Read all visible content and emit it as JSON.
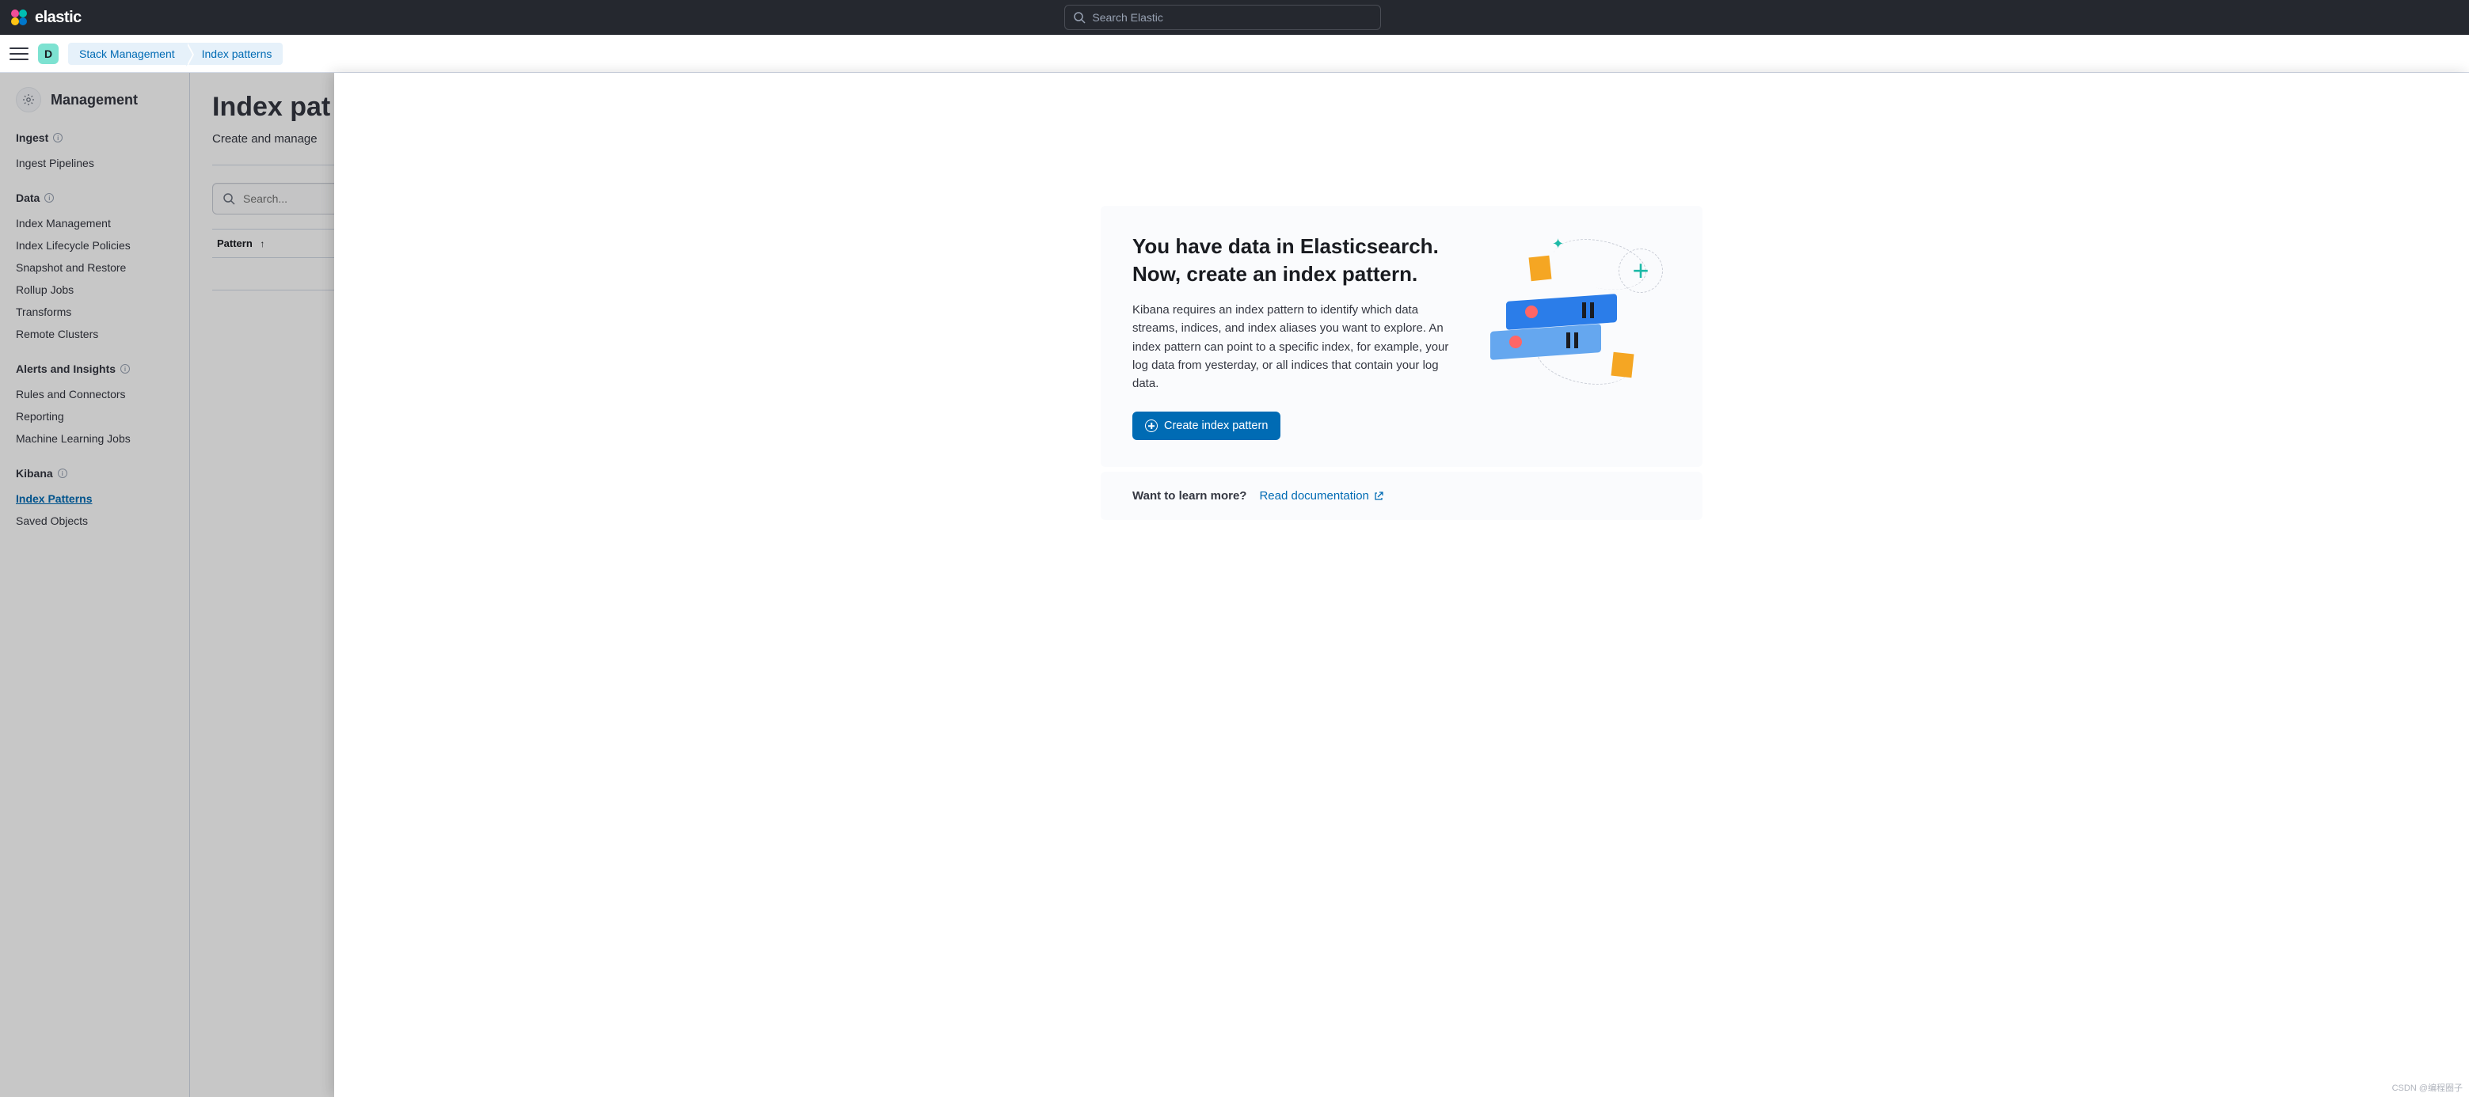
{
  "header": {
    "brand": "elastic",
    "search_placeholder": "Search Elastic"
  },
  "breadcrumb": {
    "space_letter": "D",
    "items": [
      "Stack Management",
      "Index patterns"
    ]
  },
  "sidebar": {
    "title": "Management",
    "sections": [
      {
        "title": "Ingest",
        "has_info": true,
        "items": [
          "Ingest Pipelines"
        ]
      },
      {
        "title": "Data",
        "has_info": true,
        "items": [
          "Index Management",
          "Index Lifecycle Policies",
          "Snapshot and Restore",
          "Rollup Jobs",
          "Transforms",
          "Remote Clusters"
        ]
      },
      {
        "title": "Alerts and Insights",
        "has_info": true,
        "items": [
          "Rules and Connectors",
          "Reporting",
          "Machine Learning Jobs"
        ]
      },
      {
        "title": "Kibana",
        "has_info": true,
        "items": [
          "Index Patterns",
          "Saved Objects"
        ],
        "active_item": "Index Patterns"
      }
    ]
  },
  "content": {
    "page_title": "Index pat",
    "page_desc": "Create and manage",
    "search_placeholder": "Search...",
    "table_col_pattern": "Pattern"
  },
  "flyout": {
    "prompt_title_line1": "You have data in Elasticsearch.",
    "prompt_title_line2": "Now, create an index pattern.",
    "prompt_desc": "Kibana requires an index pattern to identify which data streams, indices, and index aliases you want to explore. An index pattern can point to a specific index, for example, your log data from yesterday, or all indices that contain your log data.",
    "create_btn": "Create index pattern",
    "learn_more_label": "Want to learn more?",
    "doc_link": "Read documentation"
  },
  "watermark": "CSDN @编程圈子"
}
